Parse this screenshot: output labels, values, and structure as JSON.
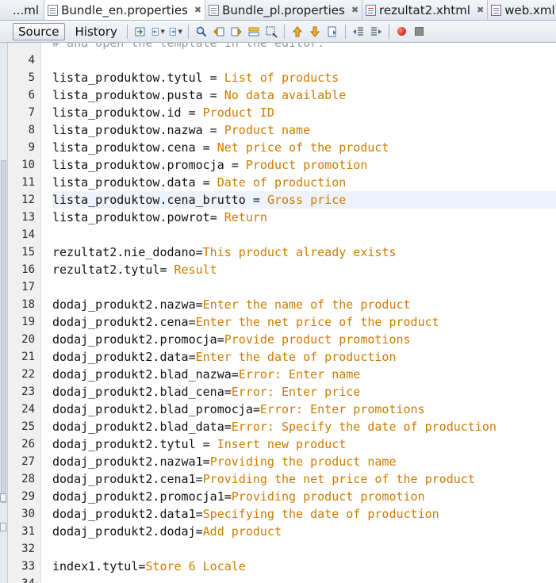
{
  "tabs": [
    {
      "label": "...ml",
      "icon": "file-icon",
      "closable": false,
      "active": false
    },
    {
      "label": "Bundle_en.properties",
      "icon": "properties-file-icon",
      "closable": true,
      "active": true
    },
    {
      "label": "Bundle_pl.properties",
      "icon": "properties-file-icon",
      "closable": true,
      "active": false
    },
    {
      "label": "rezultat2.xhtml",
      "icon": "xhtml-file-icon",
      "closable": true,
      "active": false
    },
    {
      "label": "web.xml",
      "icon": "xml-file-icon",
      "closable": true,
      "active": false
    }
  ],
  "close_glyph": "✖",
  "toolbar": {
    "source_label": "Source",
    "history_label": "History",
    "buttons": [
      "last-edit-icon",
      "back-icon",
      "forward-icon",
      "find-icon",
      "find-previous-icon",
      "find-next-icon",
      "toggle-highlight-icon",
      "toggle-rect-selection-icon",
      "previous-bookmark-icon",
      "next-bookmark-icon",
      "toggle-bookmark-icon",
      "shift-left-icon",
      "shift-right-icon",
      "start-macro-icon",
      "stop-macro-icon"
    ]
  },
  "editor": {
    "partial_top_line": "# and open the template in the editor.",
    "highlighted_line": 12,
    "lines": [
      {
        "n": "4",
        "key": "",
        "sep": "",
        "val": ""
      },
      {
        "n": "5",
        "key": "lista_produktow.tytul",
        "sep": " = ",
        "val": "List of products"
      },
      {
        "n": "6",
        "key": "lista_produktow.pusta",
        "sep": " = ",
        "val": "No data available"
      },
      {
        "n": "7",
        "key": "lista_produktow.id",
        "sep": " = ",
        "val": "Product ID"
      },
      {
        "n": "8",
        "key": "lista_produktow.nazwa",
        "sep": " = ",
        "val": "Product name"
      },
      {
        "n": "9",
        "key": "lista_produktow.cena",
        "sep": " = ",
        "val": "Net price of the product"
      },
      {
        "n": "10",
        "key": "lista_produktow.promocja",
        "sep": " = ",
        "val": "Product promotion"
      },
      {
        "n": "11",
        "key": "lista_produktow.data",
        "sep": " = ",
        "val": "Date of production"
      },
      {
        "n": "12",
        "key": "lista_produktow.cena_brutto",
        "sep": " = ",
        "val": "Gross price"
      },
      {
        "n": "13",
        "key": "lista_produktow.powrot",
        "sep": "= ",
        "val": "Return"
      },
      {
        "n": "14",
        "key": "",
        "sep": "",
        "val": ""
      },
      {
        "n": "15",
        "key": "rezultat2.nie_dodano",
        "sep": "=",
        "val": "This product already exists"
      },
      {
        "n": "16",
        "key": "rezultat2.tytul",
        "sep": "= ",
        "val": "Result"
      },
      {
        "n": "17",
        "key": "",
        "sep": "",
        "val": ""
      },
      {
        "n": "18",
        "key": "dodaj_produkt2.nazwa",
        "sep": "=",
        "val": "Enter the name of the product"
      },
      {
        "n": "19",
        "key": "dodaj_produkt2.cena",
        "sep": "=",
        "val": "Enter the net price of the product"
      },
      {
        "n": "20",
        "key": "dodaj_produkt2.promocja",
        "sep": "=",
        "val": "Provide product promotions"
      },
      {
        "n": "21",
        "key": "dodaj_produkt2.data",
        "sep": "=",
        "val": "Enter the date of production"
      },
      {
        "n": "22",
        "key": "dodaj_produkt2.blad_nazwa",
        "sep": "=",
        "val": "Error: Enter name"
      },
      {
        "n": "23",
        "key": "dodaj_produkt2.blad_cena",
        "sep": "=",
        "val": "Error: Enter price"
      },
      {
        "n": "24",
        "key": "dodaj_produkt2.blad_promocja",
        "sep": "=",
        "val": "Error: Enter promotions"
      },
      {
        "n": "25",
        "key": "dodaj_produkt2.blad_data",
        "sep": "=",
        "val": "Error: Specify the date of production"
      },
      {
        "n": "26",
        "key": "dodaj_produkt2.tytul",
        "sep": " = ",
        "val": "Insert new product"
      },
      {
        "n": "27",
        "key": "dodaj_produkt2.nazwa1",
        "sep": "=",
        "val": "Providing the product name"
      },
      {
        "n": "28",
        "key": "dodaj_produkt2.cena1",
        "sep": "=",
        "val": "Providing the net price of the product"
      },
      {
        "n": "29",
        "key": "dodaj_produkt2.promocja1",
        "sep": "=",
        "val": "Providing product promotion"
      },
      {
        "n": "30",
        "key": "dodaj_produkt2.data1",
        "sep": "=",
        "val": "Specifying the date of production"
      },
      {
        "n": "31",
        "key": "dodaj_produkt2.dodaj",
        "sep": "=",
        "val": "Add product"
      },
      {
        "n": "32",
        "key": "",
        "sep": "",
        "val": ""
      },
      {
        "n": "33",
        "key": "index1.tytul",
        "sep": "=",
        "val": "Store 6 Locale"
      },
      {
        "n": "34",
        "key": "",
        "sep": "",
        "val": ""
      }
    ]
  },
  "colors": {
    "key_text": "#111111",
    "value_text": "#ce7b00",
    "line_highlight": "#eef2fa",
    "tab_active": "#ffffff"
  }
}
